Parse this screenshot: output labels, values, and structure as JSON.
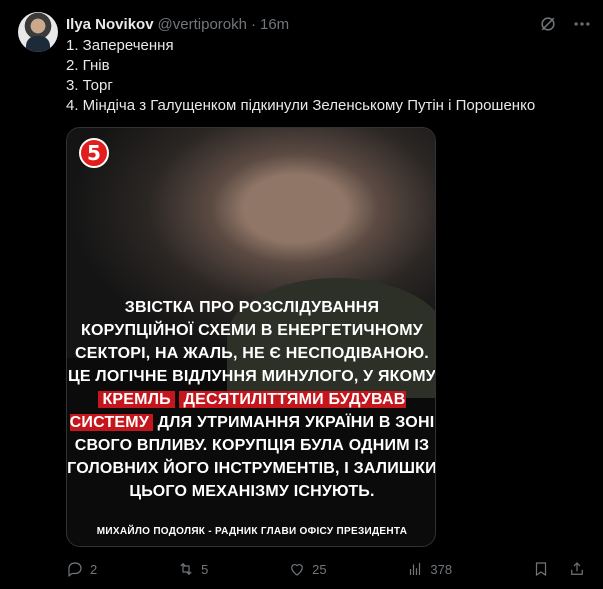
{
  "author": {
    "name": "Ilya Novikov",
    "handle": "@vertiporokh",
    "separator": "·",
    "time": "16m"
  },
  "lines": [
    "1. Заперечення",
    "2. Гнів",
    "3. Торг",
    "4. Міндіча з Галущенком підкинули Зеленському Путін і Порошенко"
  ],
  "media": {
    "channel_logo_text": "5",
    "quote_before_highlight": "Звістка про розслідування корупційної схеми в енергетичному секторі, на жаль, не є несподіваною. Це логічне відлуння минулого, у якому",
    "quote_highlight_1": "Кремль",
    "quote_highlight_2": "десятиліттями будував систему",
    "quote_after_highlight": "для утримання України в зоні свого впливу. Корупція була одним із головних його інструментів, і залишки цього механізму існують.",
    "credit": "МИХАЙЛО ПОДОЛЯК - РАДНИК ГЛАВИ ОФІСУ ПРЕЗИДЕНТА",
    "brand_color": "#c4161c"
  },
  "actions": {
    "replies": "2",
    "reposts": "5",
    "likes": "25",
    "views": "378"
  }
}
